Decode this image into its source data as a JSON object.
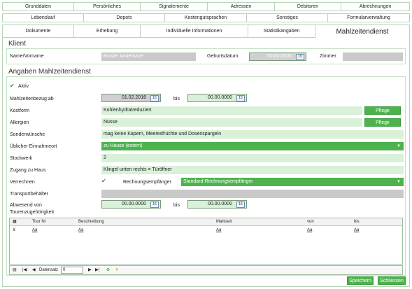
{
  "tabs_row1": [
    "Grunddaten",
    "Persönliches",
    "Signalemente",
    "Adressen",
    "Debitoren",
    "Abrechnungen"
  ],
  "tabs_row2": [
    "Lebenslauf",
    "Depots",
    "Kostengutsprachen",
    "Sonstiges",
    "Formularverwaltung"
  ],
  "tabs_row3": [
    "Dokumente",
    "Erhebung",
    "Individuelle Informationen",
    "Statistikangaben",
    "Mahlzeitendienst"
  ],
  "client": {
    "title": "Klient",
    "name_label": "Name/Vorname",
    "name_value": "Muster Annemarie",
    "birth_label": "Geburtsdatum",
    "birth_value": "00.00.0000",
    "room_label": "Zimmer",
    "room_value": ""
  },
  "meals": {
    "title": "Angaben Mahlzeitendienst",
    "active_label": "Aktiv",
    "start_label": "Mahlzeitenbezug ab",
    "start_value": "01.02.2016",
    "bis_label": "bis",
    "end_value": "00.00.0000",
    "kostform_label": "Kostform",
    "kostform_value": "Kohlenhydratreduziert",
    "allergien_label": "Allergien",
    "allergien_value": "Nüsse",
    "pflege_label": "Pflege",
    "sonder_label": "Sonderwünsche",
    "sonder_value": "mag keine Kapern, Meeresfrüchte und Dosenspargeln",
    "ort_label": "Üblicher Einnahmeort",
    "ort_value": "zu Hause (extern)",
    "stock_label": "Stockwerk",
    "stock_value": "2",
    "zugang_label": "Zugang zu Haus",
    "zugang_value": "Klingel unten rechts = Türöffner",
    "verrechnen_label": "Verrechnen",
    "empf_label": "Rechnungsempfänger",
    "empf_value": "Standard-Rechnungsempfänger",
    "transport_label": "Transportbehälter",
    "transport_value": "",
    "abwesend_label": "Abwesend von",
    "abwesend_from": "00.00.0000",
    "abwesend_to": "00.00.0000",
    "touren_label": "Tourenzugehörigkeit"
  },
  "grid": {
    "columns": [
      "Tour Nr",
      "Beschreibung",
      "Mahlzeit",
      "von",
      "bis"
    ],
    "filter_value": "Aa",
    "pager_label": "Datensatz",
    "pager_value": "0",
    "cal_icon_text": "15"
  },
  "buttons": {
    "save": "Speichern",
    "close": "Schliessen"
  },
  "colors": {
    "accent": "#4db34d",
    "field": "#d9f0d9",
    "border": "#b8d4b8"
  }
}
